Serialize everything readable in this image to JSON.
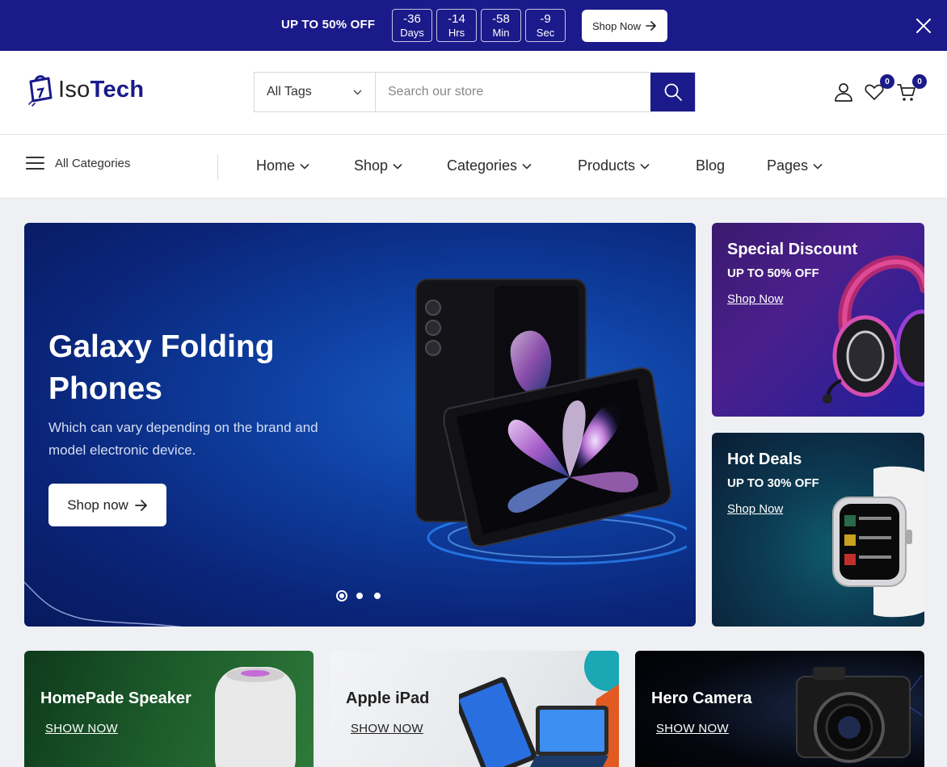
{
  "promo_bar": {
    "text": "UP TO 50% OFF",
    "countdown": [
      {
        "value": "-36",
        "unit": "Days"
      },
      {
        "value": "-14",
        "unit": "Hrs"
      },
      {
        "value": "-58",
        "unit": "Min"
      },
      {
        "value": "-9",
        "unit": "Sec"
      }
    ],
    "button_label": "Shop Now",
    "close_icon": "close-icon"
  },
  "header": {
    "logo_prefix": "Iso",
    "logo_suffix": "Tech",
    "search": {
      "category_label": "All Tags",
      "placeholder": "Search our store"
    },
    "wishlist_count": "0",
    "cart_count": "0"
  },
  "nav": {
    "all_categories_label": "All Categories",
    "items": [
      {
        "label": "Home",
        "dropdown": true
      },
      {
        "label": "Shop",
        "dropdown": true
      },
      {
        "label": "Categories",
        "dropdown": true
      },
      {
        "label": "Products",
        "dropdown": true
      },
      {
        "label": "Blog",
        "dropdown": false
      },
      {
        "label": "Pages",
        "dropdown": true
      }
    ]
  },
  "hero": {
    "title": "Galaxy Folding Phones",
    "subtitle": "Which can vary depending on the brand and model electronic device.",
    "button_label": "Shop now",
    "slide_count": 3,
    "active_slide": 1
  },
  "side_cards": [
    {
      "title": "Special Discount",
      "offer": "UP TO 50% OFF",
      "link": "Shop Now"
    },
    {
      "title": "Hot Deals",
      "offer": "UP TO 30% OFF",
      "link": "Shop Now"
    }
  ],
  "banners": [
    {
      "title": "HomePade Speaker",
      "link": "SHOW NOW"
    },
    {
      "title": "Apple iPad",
      "link": "SHOW NOW"
    },
    {
      "title": "Hero Camera",
      "link": "SHOW NOW"
    }
  ],
  "colors": {
    "brand": "#1b1a8a",
    "hero_bg": "#0e3fa0"
  }
}
